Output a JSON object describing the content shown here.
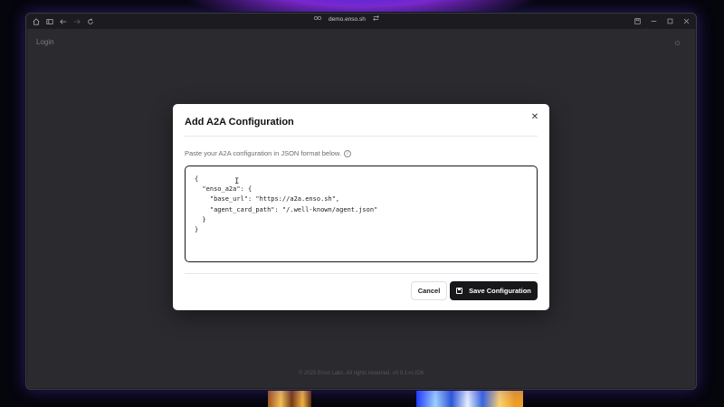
{
  "browser": {
    "url": "demo.enso.sh",
    "icons": {
      "home": "home-icon",
      "tabs": "tabs-icon",
      "back": "arrow-left-icon",
      "forward": "arrow-right-icon",
      "reload": "reload-icon",
      "site": "link-icon",
      "swap": "swap-icon",
      "save_page": "save-page-icon",
      "minimize": "minimize-icon",
      "maximize": "maximize-icon",
      "close": "close-window-icon"
    }
  },
  "page": {
    "header_label": "Login",
    "footer_text": "© 2025 Enso Labs. All rights reserved. v0.0.1-rc.ID6"
  },
  "modal": {
    "title": "Add A2A Configuration",
    "description": "Paste your A2A configuration in JSON format below.",
    "json_value": "{\n  \"enso_a2a\": {\n    \"base_url\": \"https://a2a.enso.sh\",\n    \"agent_card_path\": \"/.well-known/agent.json\"\n  }\n}",
    "cancel_label": "Cancel",
    "save_label": "Save Configuration"
  },
  "colors": {
    "modal_bg": "#ffffff",
    "primary_button": "#18181b",
    "overlay": "#2b2b2f"
  }
}
